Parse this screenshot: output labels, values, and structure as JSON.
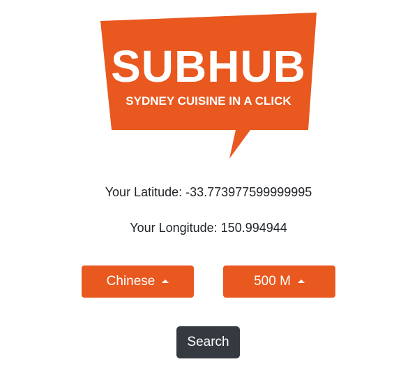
{
  "logo": {
    "title": "SUBHUB",
    "tagline": "SYDNEY CUISINE IN A CLICK",
    "color": "#e8581f"
  },
  "location": {
    "latitude_label": "Your Latitude: -33.773977599999995",
    "longitude_label": "Your Longitude: 150.994944"
  },
  "filters": {
    "cuisine_selected": "Chinese",
    "distance_selected": "500 M",
    "caret_icon": "caret-up-icon",
    "button_color": "#e8581f"
  },
  "search": {
    "label": "Search",
    "button_color": "#343a40"
  }
}
